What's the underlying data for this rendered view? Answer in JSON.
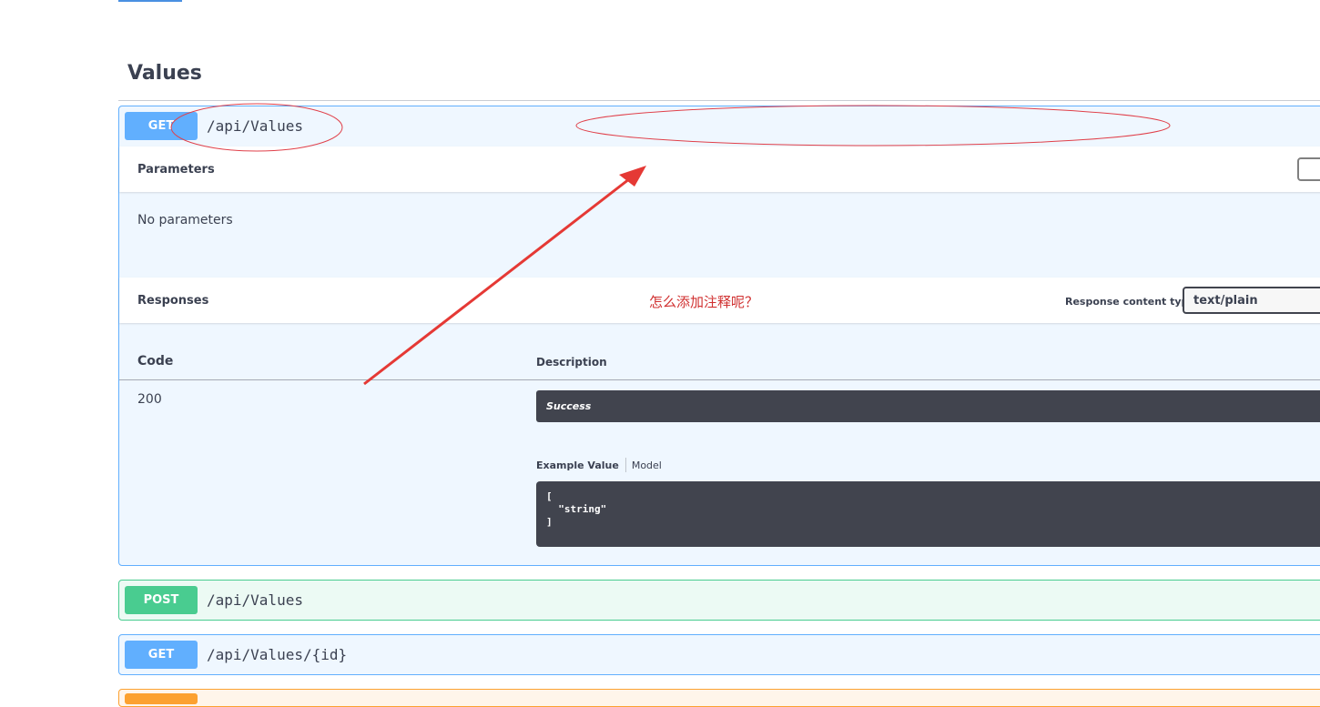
{
  "tag": {
    "title": "Values"
  },
  "operations": [
    {
      "method": "GET",
      "path": "/api/Values",
      "parameters_label": "Parameters",
      "no_parameters": "No parameters",
      "responses_label": "Responses",
      "response_content_type_label": "Response content type",
      "response_content_type_value": "text/plain",
      "table": {
        "code_header": "Code",
        "description_header": "Description",
        "rows": [
          {
            "code": "200",
            "description": "Success"
          }
        ]
      },
      "example_tabs": {
        "example_value": "Example Value",
        "model": "Model"
      },
      "example_code": "[\n  \"string\"\n]"
    },
    {
      "method": "POST",
      "path": "/api/Values"
    },
    {
      "method": "GET",
      "path": "/api/Values/{id}"
    }
  ],
  "annotation": {
    "text": "怎么添加注释呢？",
    "color": "#d03030"
  },
  "colors": {
    "get": "#61affe",
    "post": "#49cc90",
    "put": "#fca130",
    "code_bg": "#41444e"
  }
}
